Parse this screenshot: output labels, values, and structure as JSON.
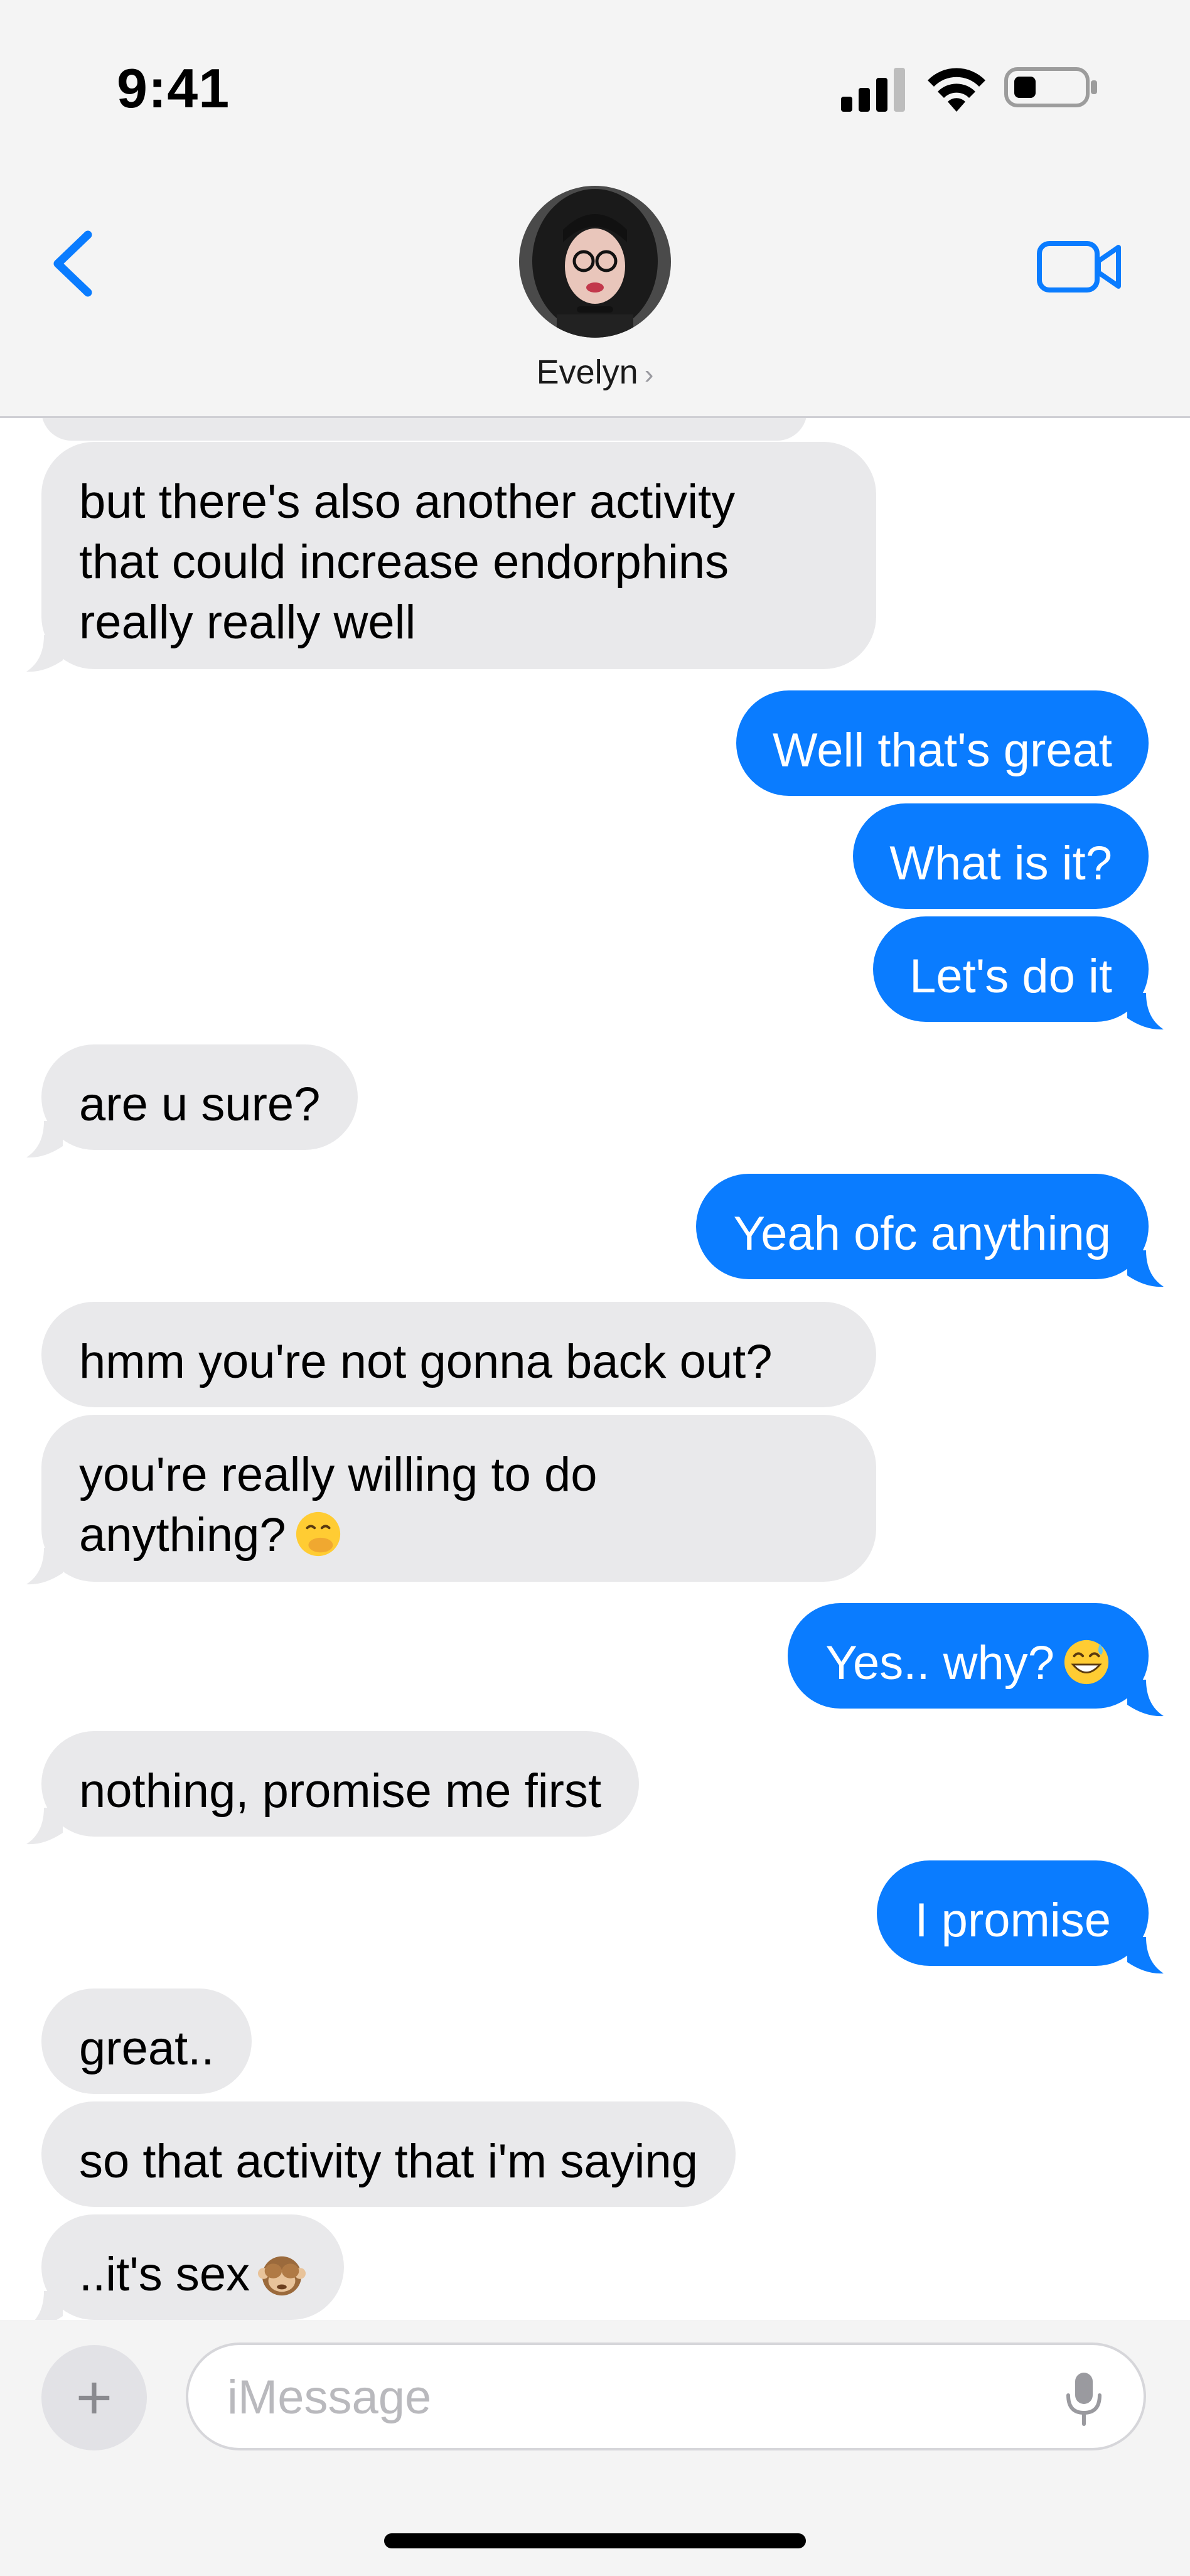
{
  "status_bar": {
    "time": "9:41"
  },
  "header": {
    "contact_name": "Evelyn",
    "chevron": "›"
  },
  "messages": [
    {
      "side": "in",
      "text_lines": [
        "but there's also another activity",
        "that could increase endorphins",
        "really really well"
      ]
    },
    {
      "side": "out",
      "text": "Well that's great"
    },
    {
      "side": "out",
      "text": "What is it?"
    },
    {
      "side": "out",
      "text": "Let's do it"
    },
    {
      "side": "in",
      "text": "are u sure?"
    },
    {
      "side": "out",
      "text": "Yeah ofc anything"
    },
    {
      "side": "in",
      "text": "hmm you're not gonna back out?"
    },
    {
      "side": "in",
      "text_lines": [
        "you're really willing to do",
        "anything?"
      ],
      "emoji": "face-with-hand-over-mouth"
    },
    {
      "side": "out",
      "text": "Yes.. why?",
      "emoji": "grinning-face-with-sweat"
    },
    {
      "side": "in",
      "text": "nothing, promise me first"
    },
    {
      "side": "out",
      "text": "I promise"
    },
    {
      "side": "in",
      "text": "great.."
    },
    {
      "side": "in",
      "text": "so that activity that i'm saying"
    },
    {
      "side": "in",
      "text": "..it's sex",
      "emoji": "see-no-evil-monkey"
    }
  ],
  "input": {
    "placeholder": "iMessage",
    "plus_label": "+"
  },
  "icons": {
    "back": "chevron-left-icon",
    "video": "video-camera-icon",
    "mic": "microphone-icon",
    "signal": "cellular-signal-icon",
    "wifi": "wifi-icon",
    "battery": "battery-icon"
  },
  "colors": {
    "accent": "#0a7cff",
    "incoming_bubble": "#e9e9eb",
    "background": "#ffffff",
    "header_bg": "#f4f4f4"
  }
}
